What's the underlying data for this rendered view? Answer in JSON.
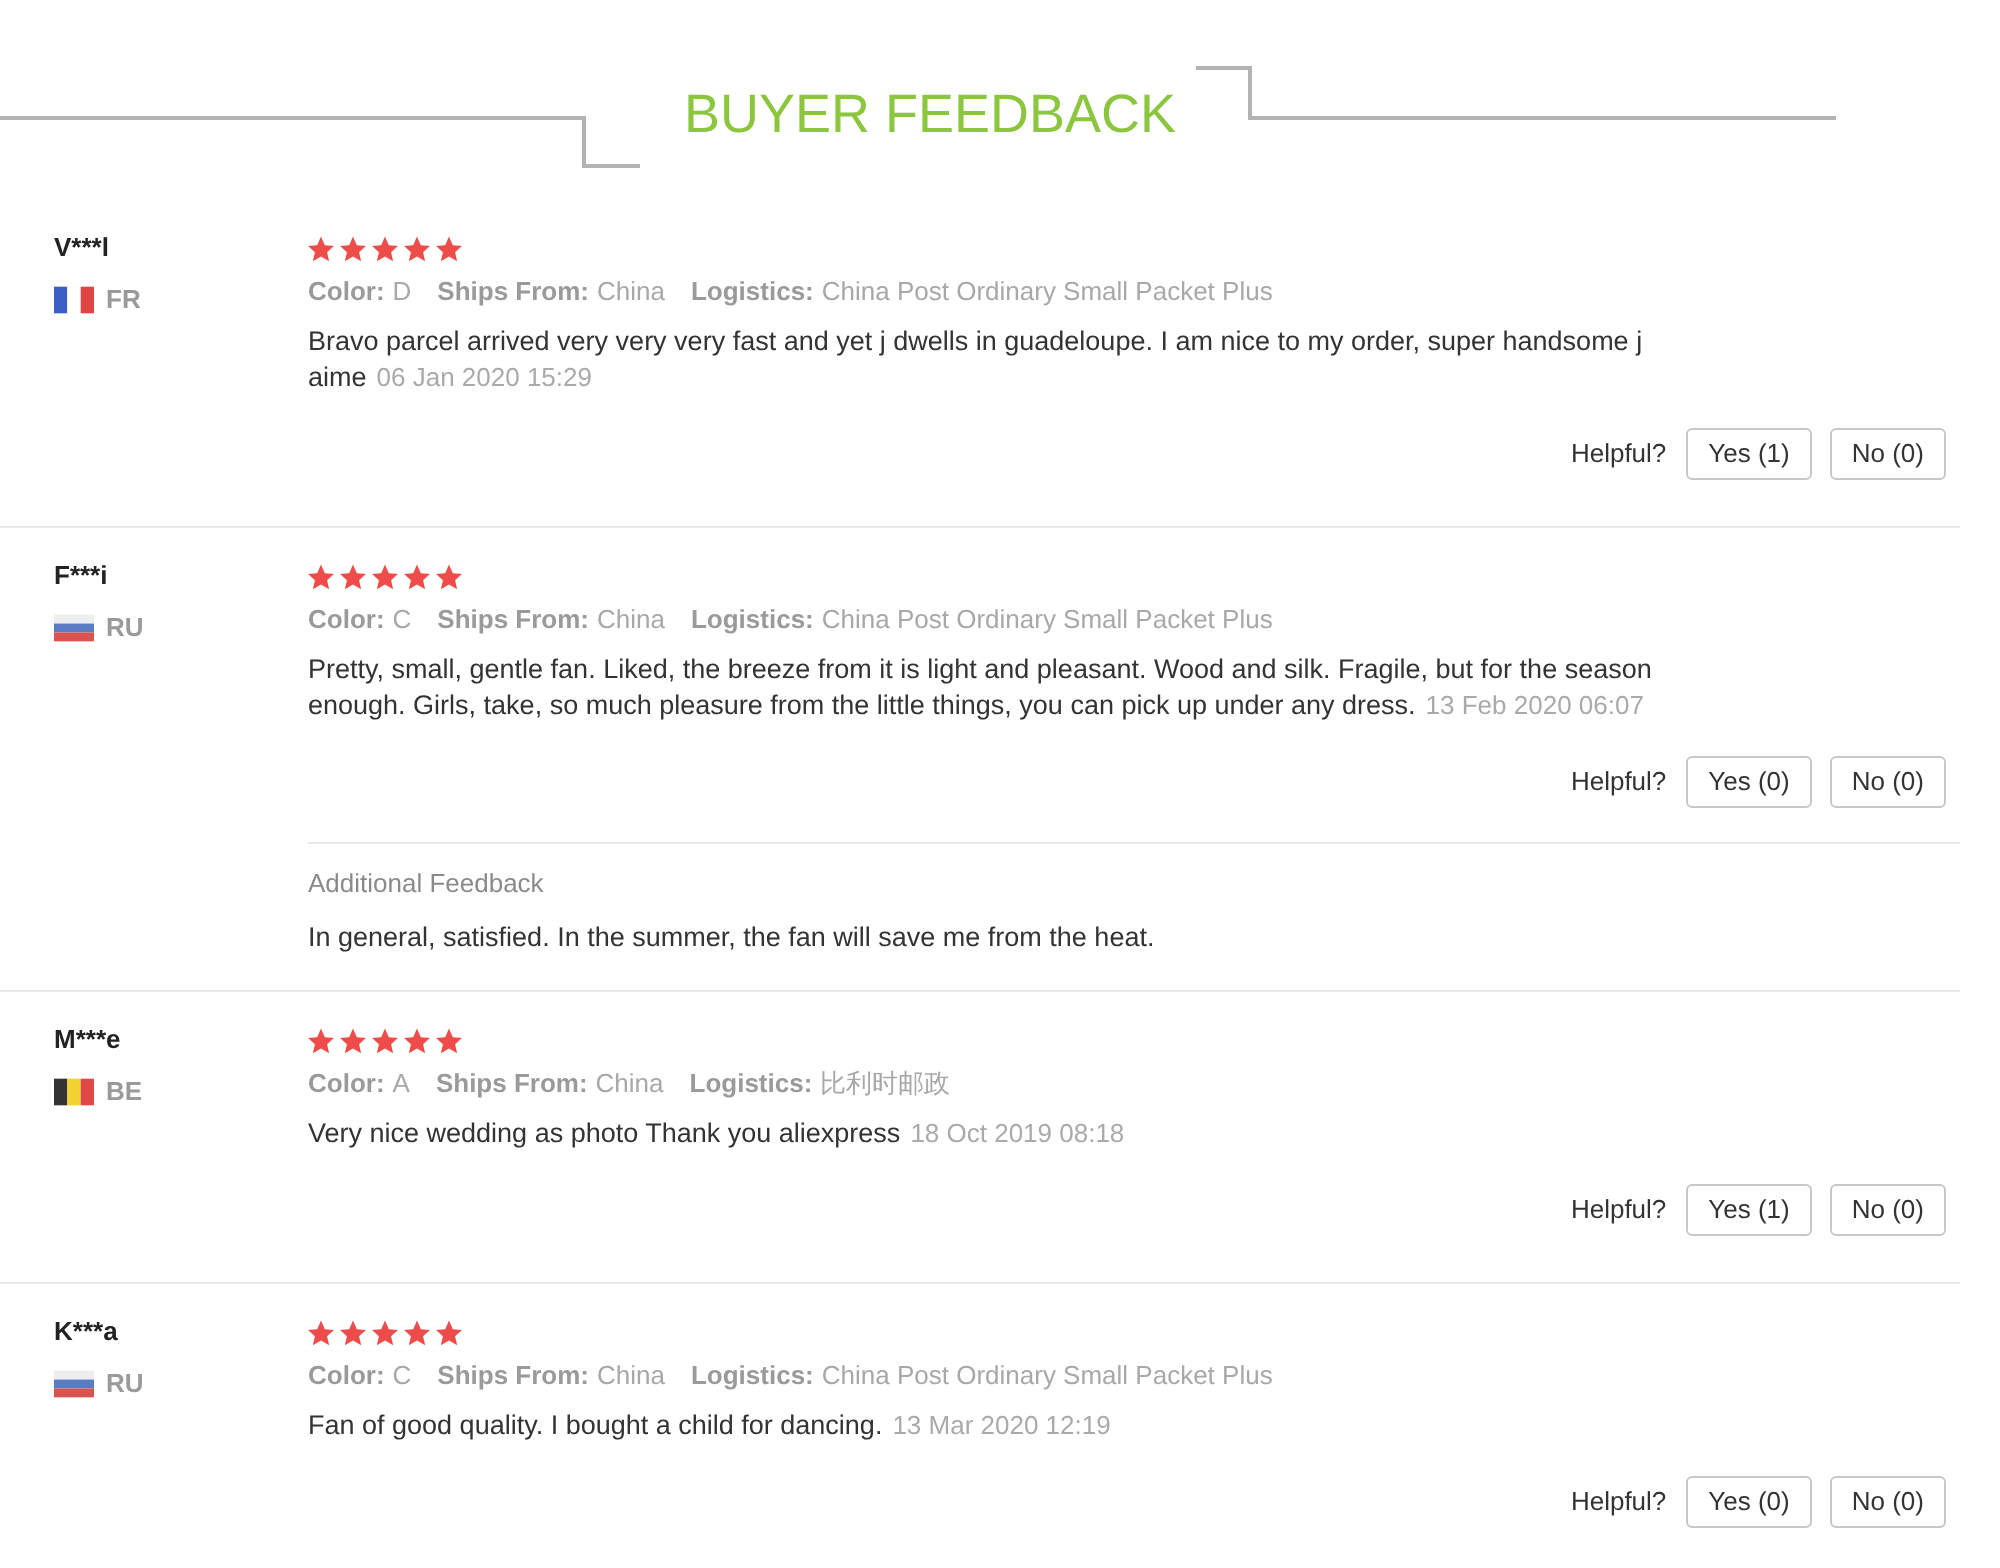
{
  "header": {
    "title": "BUYER FEEDBACK"
  },
  "reviews": [
    {
      "name": "V***l",
      "country": "FR",
      "flag": {
        "kind": "vertical",
        "stripes": [
          {
            "color": "#3d5fc4"
          },
          {
            "color": "#ffffff"
          },
          {
            "color": "#e04545"
          }
        ]
      },
      "stars": 5,
      "attributes": [
        {
          "label": "Color:",
          "value": "D"
        },
        {
          "label": "Ships From:",
          "value": "China"
        },
        {
          "label": "Logistics:",
          "value": "China Post Ordinary Small Packet Plus"
        }
      ],
      "text": "Bravo parcel arrived very very very fast and yet j dwells in guadeloupe. I am nice to my order, super handsome j aime",
      "date": "06 Jan 2020 15:29",
      "helpful": {
        "label": "Helpful?",
        "yes": "Yes (1)",
        "no": "No (0)"
      }
    },
    {
      "name": "F***i",
      "country": "RU",
      "flag": {
        "kind": "horizontal",
        "stripes": [
          {
            "color": "#eeeeee"
          },
          {
            "color": "#5b7bc4"
          },
          {
            "color": "#d9534f"
          }
        ]
      },
      "stars": 5,
      "attributes": [
        {
          "label": "Color:",
          "value": "C"
        },
        {
          "label": "Ships From:",
          "value": "China"
        },
        {
          "label": "Logistics:",
          "value": "China Post Ordinary Small Packet Plus"
        }
      ],
      "text": "Pretty, small, gentle fan. Liked, the breeze from it is light and pleasant. Wood and silk. Fragile, but for the season enough. Girls, take, so much pleasure from the little things, you can pick up under any dress.",
      "date": "13 Feb 2020 06:07",
      "helpful": {
        "label": "Helpful?",
        "yes": "Yes (0)",
        "no": "No (0)"
      },
      "additional_feedback": {
        "label": "Additional Feedback",
        "text": "In general, satisfied. In the summer, the fan will save me from the heat."
      }
    },
    {
      "name": "M***e",
      "country": "BE",
      "flag": {
        "kind": "vertical",
        "stripes": [
          {
            "color": "#333333"
          },
          {
            "color": "#f2d232"
          },
          {
            "color": "#e04848"
          }
        ]
      },
      "stars": 5,
      "attributes": [
        {
          "label": "Color:",
          "value": "A"
        },
        {
          "label": "Ships From:",
          "value": "China"
        },
        {
          "label": "Logistics:",
          "value": "比利时邮政"
        }
      ],
      "text": "Very nice wedding as photo Thank you aliexpress",
      "date": "18 Oct 2019 08:18",
      "helpful": {
        "label": "Helpful?",
        "yes": "Yes (1)",
        "no": "No (0)"
      }
    },
    {
      "name": "K***a",
      "country": "RU",
      "flag": {
        "kind": "horizontal",
        "stripes": [
          {
            "color": "#eeeeee"
          },
          {
            "color": "#5b7bc4"
          },
          {
            "color": "#d9534f"
          }
        ]
      },
      "stars": 5,
      "attributes": [
        {
          "label": "Color:",
          "value": "C"
        },
        {
          "label": "Ships From:",
          "value": "China"
        },
        {
          "label": "Logistics:",
          "value": "China Post Ordinary Small Packet Plus"
        }
      ],
      "text": "Fan of good quality. I bought a child for dancing.",
      "date": "13 Mar 2020 12:19",
      "helpful": {
        "label": "Helpful?",
        "yes": "Yes (0)",
        "no": "No (0)"
      }
    }
  ]
}
